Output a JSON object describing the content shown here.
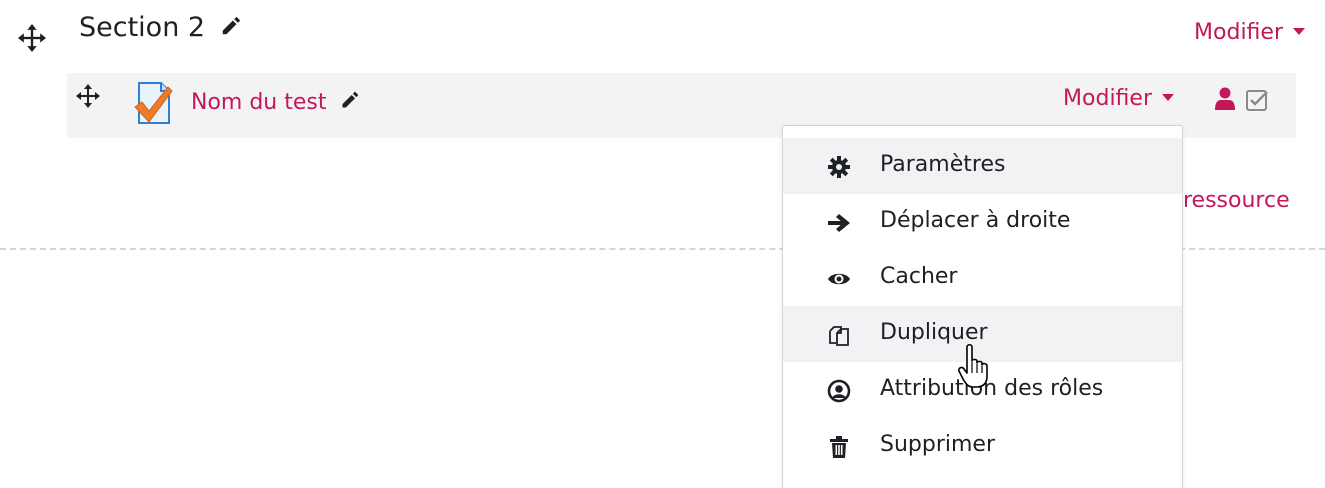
{
  "section": {
    "title": "Section 2",
    "edit_label": "Modifier"
  },
  "activity": {
    "name": "Nom du test",
    "edit_label": "Modifier"
  },
  "add_resource_label": "ressource",
  "menu": {
    "items": [
      {
        "label": "Paramètres",
        "icon": "gear-icon"
      },
      {
        "label": "Déplacer à droite",
        "icon": "arrow-right-icon"
      },
      {
        "label": "Cacher",
        "icon": "eye-icon"
      },
      {
        "label": "Dupliquer",
        "icon": "copy-icon"
      },
      {
        "label": "Attribution des rôles",
        "icon": "user-circle-icon"
      },
      {
        "label": "Supprimer",
        "icon": "trash-icon"
      }
    ]
  },
  "colors": {
    "accent": "#c2185b",
    "text": "#1d2125",
    "row_bg": "#f3f3f3",
    "menu_highlight": "#f2f2f4"
  }
}
